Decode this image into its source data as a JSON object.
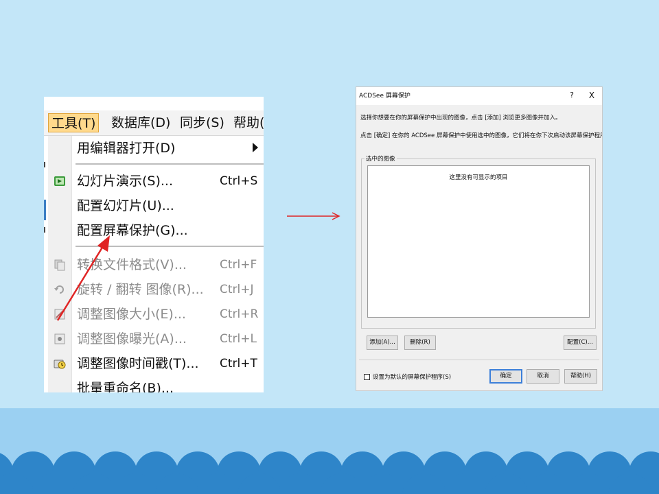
{
  "menu": {
    "menubar": [
      {
        "label": "工具(T)",
        "active": true
      },
      {
        "label": "数据库(D)",
        "active": false
      },
      {
        "label": "同步(S)",
        "active": false
      },
      {
        "label": "帮助(",
        "active": false
      }
    ],
    "items": [
      {
        "label": "用编辑器打开(D)",
        "shortcut": "",
        "disabled": false,
        "submenu": true
      },
      {
        "label": "幻灯片演示(S)...",
        "shortcut": "Ctrl+S",
        "disabled": false
      },
      {
        "label": "配置幻灯片(U)...",
        "shortcut": "",
        "disabled": false
      },
      {
        "label": "配置屏幕保护(G)...",
        "shortcut": "",
        "disabled": false
      },
      {
        "label": "转换文件格式(V)...",
        "shortcut": "Ctrl+F",
        "disabled": true
      },
      {
        "label": "旋转 / 翻转 图像(R)...",
        "shortcut": "Ctrl+J",
        "disabled": true
      },
      {
        "label": "调整图像大小(E)...",
        "shortcut": "Ctrl+R",
        "disabled": true
      },
      {
        "label": "调整图像曝光(A)...",
        "shortcut": "Ctrl+L",
        "disabled": true
      },
      {
        "label": "调整图像时间戳(T)...",
        "shortcut": "Ctrl+T",
        "disabled": false
      },
      {
        "label": "批量重命名(B)...",
        "shortcut": "",
        "disabled": false
      }
    ]
  },
  "dialog": {
    "title": "ACDSee 屏幕保护",
    "help_glyph": "?",
    "close_glyph": "X",
    "line1": "选择你想要在你的屏幕保护中出现的图像，点击 [添加] 浏览更多图像并加入。",
    "line2": "点击 [确定] 在你的 ACDSee 屏幕保护中使用选中的图像，它们将在你下次启动该屏幕保护程序时出现。",
    "group_label": "选中的图像",
    "empty_text": "这里没有可显示的项目",
    "buttons": {
      "add": "添加(A)...",
      "delete": "删除(R)",
      "config": "配置(C)...",
      "ok": "确定",
      "cancel": "取消",
      "help": "帮助(H)"
    },
    "default_checkbox_label": "设置为默认的屏幕保护程序(S)",
    "default_checked": false
  },
  "colors": {
    "background": "#c3e6f8",
    "band": "#9bd0f2",
    "waves": "#2e85c9",
    "arrow": "#e02424",
    "menu_highlight": "#ffd98c"
  },
  "icons": [
    "slideshow-icon",
    "convert-format-icon",
    "rotate-icon",
    "resize-icon",
    "exposure-icon",
    "timestamp-icon"
  ]
}
